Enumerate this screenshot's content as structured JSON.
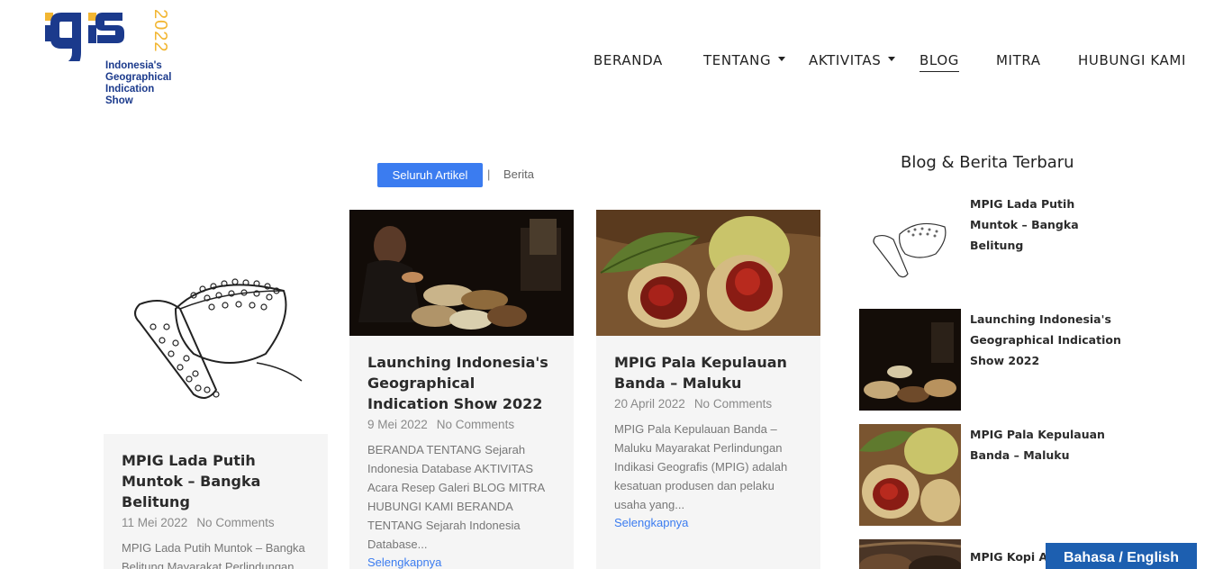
{
  "logo": {
    "brand": "igis",
    "year": "2022",
    "subtitle_lines": [
      "Indonesia's",
      "Geographical",
      "Indication",
      "Show"
    ]
  },
  "nav": {
    "items": [
      {
        "label": "BERANDA",
        "has_dropdown": false,
        "active": false
      },
      {
        "label": "TENTANG",
        "has_dropdown": true,
        "active": false
      },
      {
        "label": "AKTIVITAS",
        "has_dropdown": true,
        "active": false
      },
      {
        "label": "BLOG",
        "has_dropdown": false,
        "active": true
      },
      {
        "label": "MITRA",
        "has_dropdown": false,
        "active": false
      },
      {
        "label": "HUBUNGI KAMI",
        "has_dropdown": false,
        "active": false
      }
    ]
  },
  "filters": {
    "all_label": "Seluruh Artikel",
    "separator": "|",
    "news_label": "Berita"
  },
  "posts": [
    {
      "title": "MPIG Lada Putih Muntok – Bangka Belitung",
      "date": "11 Mei 2022",
      "comments": "No Comments",
      "excerpt": "MPIG Lada Putih Muntok – Bangka Belitung Mayarakat Perlindungan Indikasi Geografis (MPIG) adalah",
      "read_more": ""
    },
    {
      "title": "Launching Indonesia's Geographical Indication Show 2022",
      "date": "9 Mei 2022",
      "comments": "No Comments",
      "excerpt": "BERANDA TENTANG Sejarah Indonesia Database AKTIVITAS Acara Resep Galeri BLOG MITRA HUBUNGI KAMI BERANDA TENTANG Sejarah Indonesia Database...",
      "read_more": "Selengkapnya"
    },
    {
      "title": "MPIG Pala Kepulauan Banda – Maluku",
      "date": "20 April 2022",
      "comments": "No Comments",
      "excerpt": "MPIG Pala Kepulauan Banda – Maluku Mayarakat Perlindungan Indikasi Geografis (MPIG) adalah kesatuan produsen dan pelaku usaha yang...",
      "read_more": "Selengkapnya"
    }
  ],
  "sidebar": {
    "title": "Blog & Berita Terbaru",
    "items": [
      {
        "title": "MPIG Lada Putih Muntok – Bangka Belitung"
      },
      {
        "title": "Launching Indonesia's Geographical Indication Show 2022"
      },
      {
        "title": "MPIG Pala Kepulauan Banda – Maluku"
      },
      {
        "title": "MPIG Kopi Ar"
      }
    ]
  },
  "language_button": "Bahasa / English",
  "colors": {
    "accent_blue": "#3b7cf0",
    "brand_navy": "#1b3a8c",
    "brand_gold": "#f2b632",
    "lang_button": "#1d5fb0"
  }
}
